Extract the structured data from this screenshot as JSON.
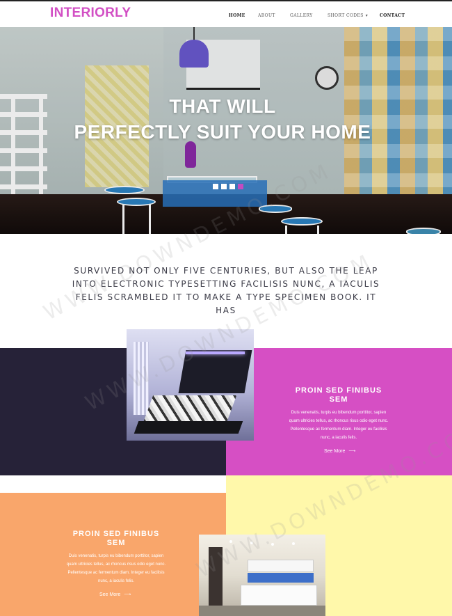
{
  "header": {
    "logo": "INTERIORLY",
    "nav": [
      {
        "label": "HOME",
        "active": true
      },
      {
        "label": "ABOUT",
        "active": false
      },
      {
        "label": "GALLERY",
        "active": false
      },
      {
        "label": "SHORT CODES",
        "active": false,
        "dropdown": true
      },
      {
        "label": "CONTACT",
        "active": false
      }
    ]
  },
  "hero": {
    "title_line1": "THAT WILL",
    "title_line2": "PERFECTLY SUIT YOUR HOME",
    "slides": 4,
    "active_slide": 4
  },
  "intro": {
    "text": "SURVIVED NOT ONLY FIVE CENTURIES, BUT ALSO THE LEAP INTO ELECTRONIC TYPESETTING FACILISIS NUNC, A IACULIS FELIS SCRAMBLED IT TO MAKE A TYPE SPECIMEN BOOK. IT HAS"
  },
  "block1": {
    "title": "PROIN SED FINIBUS SEM",
    "text": "Duis venenatis, turpis eu bibendum porttitor, sapien quam ultricies tellus, ac rhoncus risus odio eget nunc. Pellentesque ac fermentum diam. Integer eu facilisis nunc, a iaculis felis.",
    "link": "See More"
  },
  "block2": {
    "title": "PROIN SED FINIBUS SEM",
    "text": "Duis venenatis, turpis eu bibendum porttitor, sapien quam ultricies tellus, ac rhoncus risus odio eget nunc. Pellentesque ac fermentum diam. Integer eu facilisis nunc, a iaculis felis.",
    "link": "See More"
  },
  "colors": {
    "brand": "#d24fc4",
    "navy": "#262238",
    "pink": "#d64fc4",
    "orange": "#f9a66b",
    "yellow": "#fff8aa"
  },
  "icons": {
    "arrow": "arrow-right-icon",
    "caret": "chevron-down-icon"
  }
}
